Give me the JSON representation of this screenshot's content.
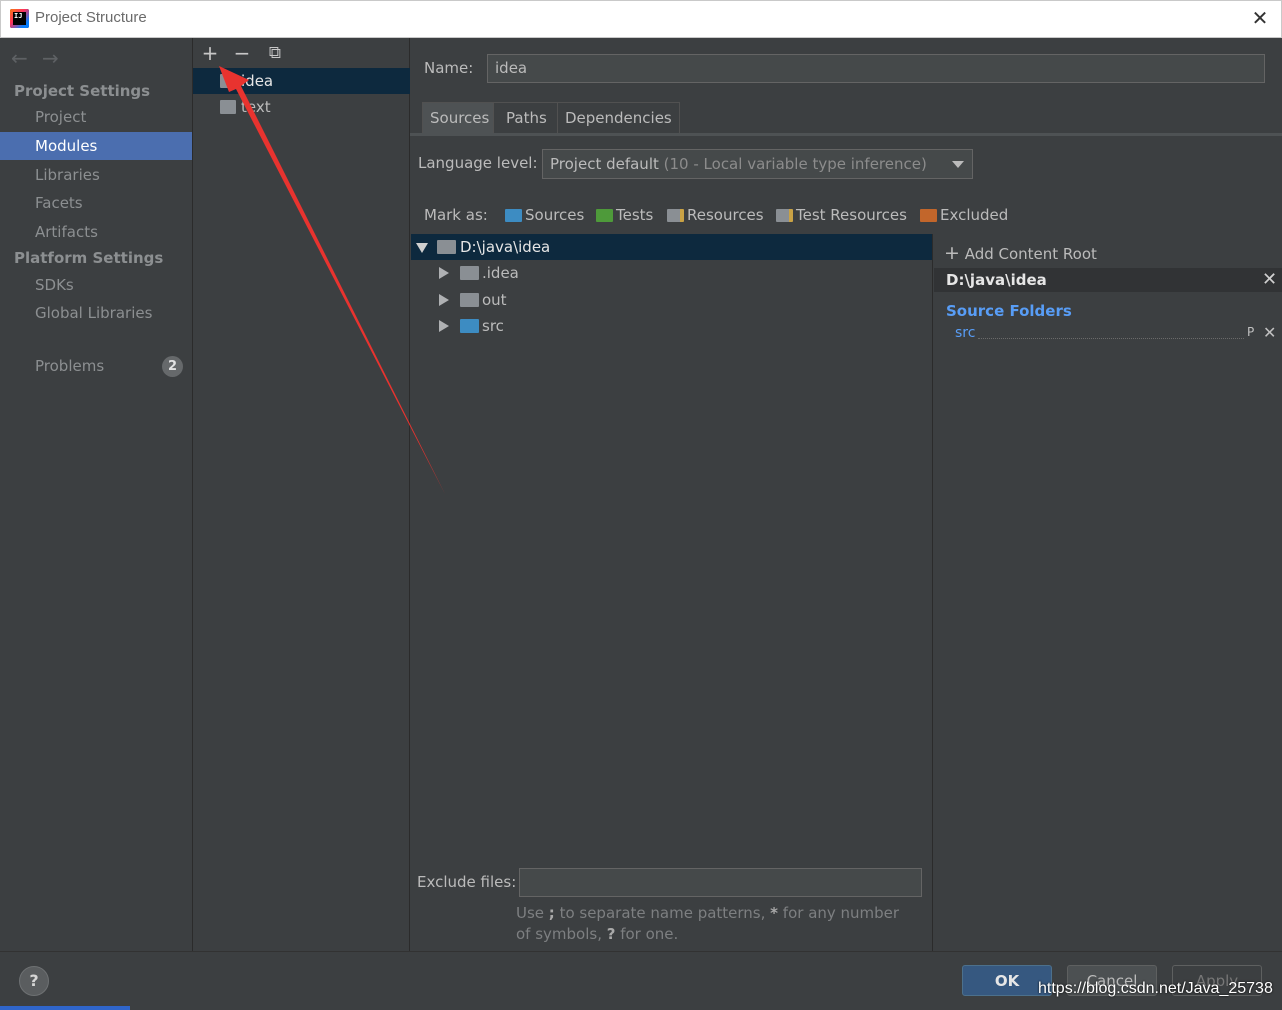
{
  "window": {
    "title": "Project Structure",
    "close_glyph": "✕"
  },
  "nav": {
    "back_glyph": "←",
    "forward_glyph": "→"
  },
  "sidebar": {
    "project_settings_heading": "Project Settings",
    "project_items": [
      {
        "label": "Project",
        "selected": false
      },
      {
        "label": "Modules",
        "selected": true
      },
      {
        "label": "Libraries",
        "selected": false
      },
      {
        "label": "Facets",
        "selected": false
      },
      {
        "label": "Artifacts",
        "selected": false
      }
    ],
    "platform_settings_heading": "Platform Settings",
    "platform_items": [
      {
        "label": "SDKs"
      },
      {
        "label": "Global Libraries"
      }
    ],
    "problems": {
      "label": "Problems",
      "count": "2"
    }
  },
  "modules_toolbar": {
    "add_glyph": "+",
    "remove_glyph": "−",
    "copy_glyph": "⧉"
  },
  "modules": [
    {
      "name": "idea",
      "selected": true
    },
    {
      "name": "text",
      "selected": false
    }
  ],
  "module_form": {
    "name_label": "Name:",
    "name_value": "idea",
    "tabs": [
      {
        "label": "Sources",
        "selected": true
      },
      {
        "label": "Paths",
        "selected": false
      },
      {
        "label": "Dependencies",
        "selected": false
      }
    ],
    "language_level_label": "Language level:",
    "language_level_value": "Project default",
    "language_level_hint": "(10 - Local variable type inference)",
    "mark_as_label": "Mark as:",
    "mark_as": [
      {
        "label": "Sources",
        "color": "#3d8cc2"
      },
      {
        "label": "Tests",
        "color": "#4e9a3a"
      },
      {
        "label": "Resources",
        "color": "#8a8f94"
      },
      {
        "label": "Test Resources",
        "color": "#8a8f94"
      },
      {
        "label": "Excluded",
        "color": "#c2662b"
      }
    ]
  },
  "tree": {
    "root": {
      "label": "D:\\java\\idea",
      "expanded": true
    },
    "children": [
      {
        "label": ".idea",
        "color": "#8a8f94"
      },
      {
        "label": "out",
        "color": "#8a8f94"
      },
      {
        "label": "src",
        "color": "#3d8cc2"
      }
    ]
  },
  "content_root": {
    "add_label": "Add Content Root",
    "add_glyph": "+",
    "path": "D:\\java\\idea",
    "close_glyph": "✕",
    "source_folders_title": "Source Folders",
    "source_folders": [
      {
        "name": "src"
      }
    ],
    "prop_glyph": "P",
    "remove_glyph": "✕"
  },
  "exclude": {
    "label": "Exclude files:",
    "value": "",
    "hint_before": "Use ",
    "hint_sep": ";",
    "hint_middle": " to separate name patterns, ",
    "hint_star": "*",
    "hint_after_star": " for any number of symbols, ",
    "hint_q": "?",
    "hint_end": " for one."
  },
  "buttons": {
    "help": "?",
    "ok": "OK",
    "cancel": "Cancel",
    "apply": "Apply"
  },
  "watermark": "https://blog.csdn.net/Java_25738",
  "annotation": {
    "color": "#e8332f"
  }
}
